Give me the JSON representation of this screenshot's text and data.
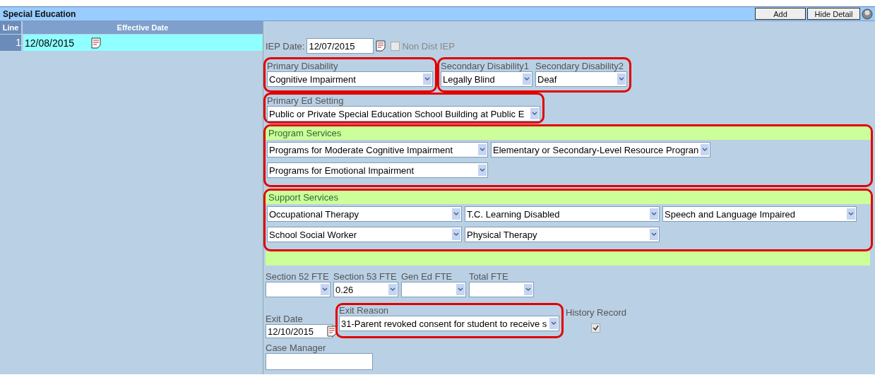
{
  "title": "Special Education",
  "buttons": [
    {
      "label": "Add"
    },
    {
      "label": "Hide Detail"
    }
  ],
  "lines": {
    "columns": [
      "Line",
      "Effective Date"
    ],
    "rows": [
      {
        "line": "1",
        "date": "12/08/2015",
        "selected": true
      }
    ]
  },
  "iep_date": {
    "label": "IEP Date:",
    "value": "12/07/2015"
  },
  "non_dist_iep": {
    "label": "Non Dist IEP",
    "checked": false
  },
  "disability_groups": [
    {
      "highlighted": true,
      "fields": [
        {
          "label": "Primary Disability",
          "value": "Cognitive Impairment"
        }
      ]
    },
    {
      "highlighted": true,
      "fields": [
        {
          "label": "Secondary Disability1",
          "value": "Legally Blind"
        },
        {
          "label": "Secondary Disability2",
          "value": "Deaf"
        }
      ]
    }
  ],
  "ed_setting": {
    "highlighted": true,
    "label": "Primary Ed Setting",
    "value": "Public or Private Special Education School Building at Public E"
  },
  "service_sections": [
    {
      "title": "Program Services",
      "highlighted": true,
      "rows": [
        [
          "Programs for Moderate Cognitive Impairment",
          "Elementary or Secondary-Level Resource Progran"
        ],
        [
          "Programs for Emotional Impairment"
        ]
      ]
    },
    {
      "title": "Support Services",
      "highlighted": true,
      "rows": [
        [
          "Occupational Therapy",
          "T.C. Learning Disabled",
          "Speech and Language Impaired"
        ],
        [
          "School Social Worker",
          "Physical Therapy"
        ]
      ]
    }
  ],
  "fte": [
    {
      "label": "Section 52 FTE"
    },
    {
      "label": "Section 53 FTE",
      "value": "0.26"
    },
    {
      "label": "Gen Ed FTE"
    },
    {
      "label": "Total FTE"
    }
  ],
  "exit_date": {
    "label": "Exit Date",
    "value": "12/10/2015"
  },
  "exit_reason": {
    "highlighted": true,
    "label": "Exit Reason",
    "value": "31-Parent revoked consent for student to receive s"
  },
  "history_record": {
    "label": "History Record",
    "checked": true
  },
  "case_manager": {
    "label": "Case Manager"
  }
}
